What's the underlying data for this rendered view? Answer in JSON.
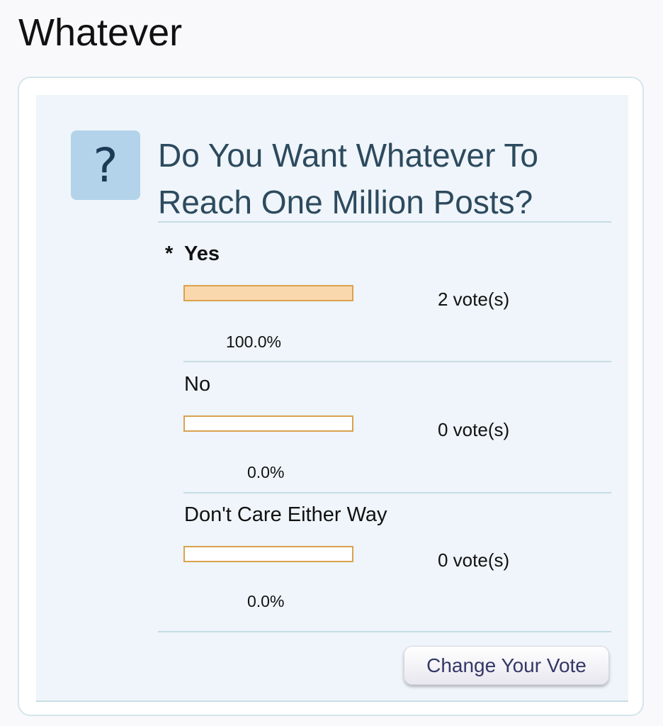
{
  "page": {
    "title": "Whatever"
  },
  "poll": {
    "question": "Do You Want Whatever To Reach One Million Posts?",
    "icon": "question-mark-icon",
    "selected_marker": "*",
    "choices": [
      {
        "label": "Yes",
        "votes": "2 vote(s)",
        "percent": "100.0%",
        "fraction": 1.0,
        "selected": true
      },
      {
        "label": "No",
        "votes": "0 vote(s)",
        "percent": "0.0%",
        "fraction": 0.0,
        "selected": false
      },
      {
        "label": "Don't Care Either Way",
        "votes": "0 vote(s)",
        "percent": "0.0%",
        "fraction": 0.0,
        "selected": false
      }
    ],
    "change_vote_label": "Change Your Vote"
  },
  "colors": {
    "bar_fill": "#fad8ad",
    "bar_border": "#daa24f",
    "icon_background": "#b3d3ea",
    "question_text": "#2d4a5e"
  }
}
